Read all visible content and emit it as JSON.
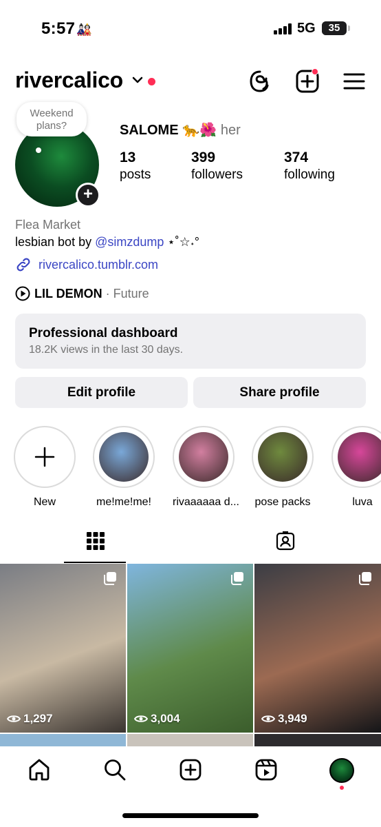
{
  "status_bar": {
    "time": "5:57",
    "time_glyph": "🎎",
    "network": "5G",
    "battery": "35",
    "battery_level": 0.35
  },
  "header": {
    "username": "rivercalico"
  },
  "profile": {
    "note": "Weekend plans?",
    "display_name": "SALOME 🐆🌺",
    "pronouns": "her",
    "stats": [
      {
        "value": "13",
        "label": "posts"
      },
      {
        "value": "399",
        "label": "followers"
      },
      {
        "value": "374",
        "label": "following"
      }
    ],
    "category": "Flea Market",
    "bio_prefix": "lesbian bot by ",
    "bio_mention": "@simzdump",
    "bio_suffix": " ⋆˚☆˖°",
    "link": "rivercalico.tumblr.com",
    "song": "LIL DEMON",
    "artist": "· Future"
  },
  "dashboard": {
    "title": "Professional dashboard",
    "subtitle": "18.2K views in the last 30 days."
  },
  "buttons": {
    "edit": "Edit profile",
    "share": "Share profile"
  },
  "highlights": [
    {
      "label": "New",
      "color": ""
    },
    {
      "label": "me!me!me!",
      "color": "#7aa8d8"
    },
    {
      "label": "rivaaaaaa d...",
      "color": "#d27fa0"
    },
    {
      "label": "pose packs",
      "color": "#6f8a3e"
    },
    {
      "label": "luva",
      "color": "#d7479a"
    }
  ],
  "tabs": {
    "grid_icon": "grid-icon",
    "tagged_icon": "tagged-icon"
  },
  "grid": [
    {
      "views": "1,297",
      "colors": [
        "#7a7d84",
        "#c8b9a3",
        "#3a3430"
      ]
    },
    {
      "views": "3,004",
      "colors": [
        "#7fb5de",
        "#5f8a4a",
        "#3b5d2c"
      ]
    },
    {
      "views": "3,949",
      "colors": [
        "#3b3d44",
        "#9c6a52",
        "#141518"
      ]
    }
  ],
  "bottom_nav": [
    "home-icon",
    "search-icon",
    "create-icon",
    "reels-icon",
    "profile-avatar"
  ]
}
